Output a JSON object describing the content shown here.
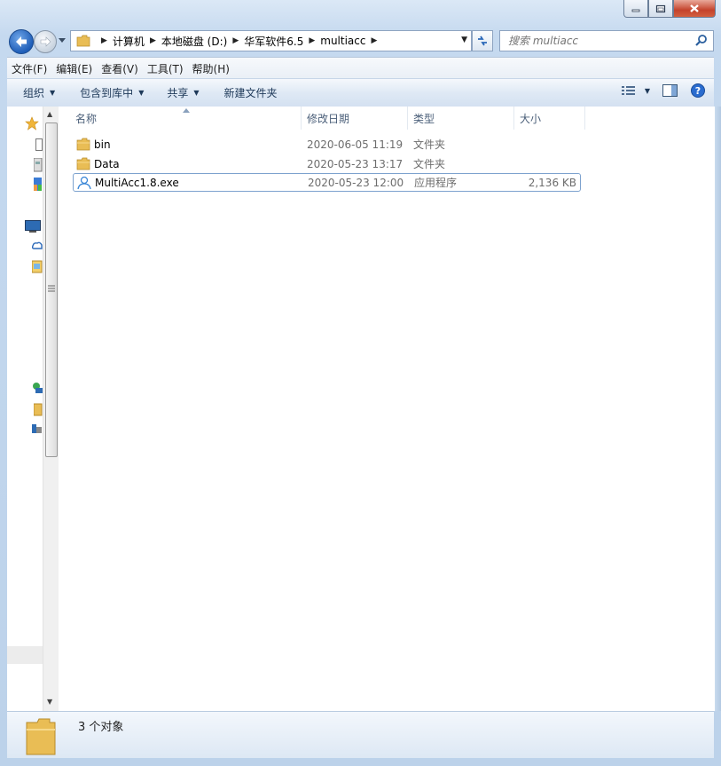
{
  "window": {
    "minimize_icon": "minimize-icon",
    "maximize_icon": "maximize-icon",
    "close_icon": "close-icon"
  },
  "address": {
    "crumbs": [
      "计算机",
      "本地磁盘 (D:)",
      "华军软件6.5",
      "multiacc"
    ]
  },
  "search": {
    "placeholder": "搜索 multiacc"
  },
  "menu": [
    "文件(F)",
    "编辑(E)",
    "查看(V)",
    "工具(T)",
    "帮助(H)"
  ],
  "commands": {
    "organize": "组织",
    "include_library": "包含到库中",
    "share": "共享",
    "new_folder": "新建文件夹"
  },
  "columns": {
    "name": "名称",
    "date": "修改日期",
    "type": "类型",
    "size": "大小"
  },
  "files": [
    {
      "name": "bin",
      "date": "2020-06-05 11:19",
      "type": "文件夹",
      "size": "",
      "icon": "folder-icon"
    },
    {
      "name": "Data",
      "date": "2020-05-23 13:17",
      "type": "文件夹",
      "size": "",
      "icon": "folder-icon"
    },
    {
      "name": "MultiAcc1.8.exe",
      "date": "2020-05-23 12:00",
      "type": "应用程序",
      "size": "2,136 KB",
      "icon": "user-app-icon"
    }
  ],
  "status": {
    "count": "3 个对象"
  },
  "colors": {
    "accent": "#1f5eb8",
    "folder": "#e8b84a",
    "selection": "#7da2ce"
  }
}
